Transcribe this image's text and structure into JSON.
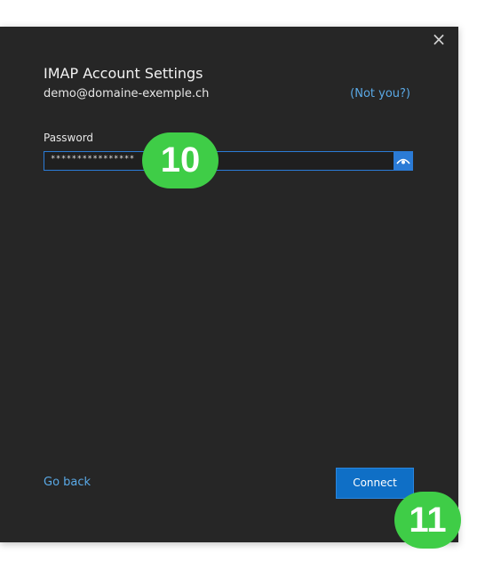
{
  "dialog": {
    "close_icon": "×",
    "title": "IMAP Account Settings",
    "email": "demo@domaine-exemple.ch",
    "not_you_label": "(Not you?)",
    "password_label": "Password",
    "password_value": "****************",
    "show_password_icon": "eye-icon",
    "go_back_label": "Go back",
    "connect_label": "Connect",
    "accent_color": "#0f6fc6",
    "link_color": "#5aa9e6"
  },
  "annotations": {
    "step_10": "10",
    "step_11": "11",
    "badge_color": "#3fcd47"
  }
}
